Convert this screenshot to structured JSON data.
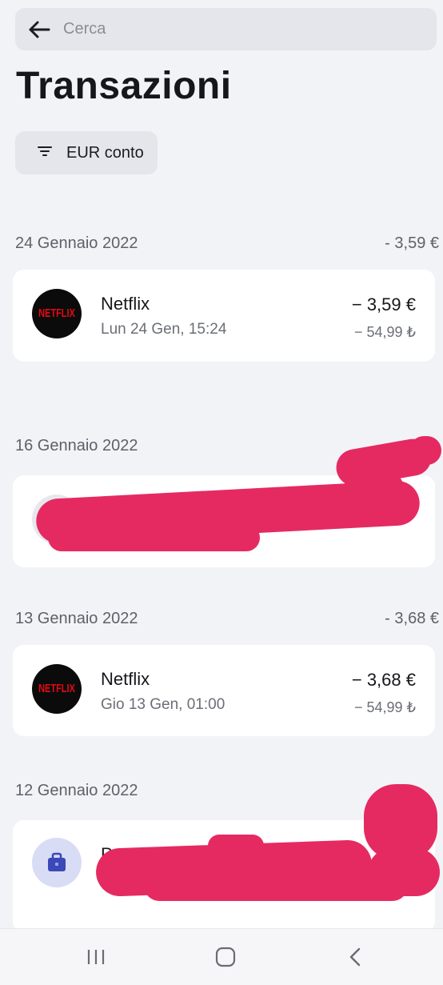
{
  "search": {
    "placeholder": "Cerca"
  },
  "page": {
    "title": "Transazioni"
  },
  "filter": {
    "label": "EUR conto"
  },
  "groups": [
    {
      "date": "24 Gennaio 2022",
      "total": "- 3,59 €",
      "transaction": {
        "merchant": "Netflix",
        "logo_text": "NETFLIX",
        "datetime": "Lun 24 Gen, 15:24",
        "amount": "− 3,59 €",
        "sub_amount": "− 54,99 ₺"
      }
    },
    {
      "date": "16 Gennaio 2022",
      "total": "",
      "transaction": {
        "redacted": true
      }
    },
    {
      "date": "13 Gennaio 2022",
      "total": "- 3,68 €",
      "transaction": {
        "merchant": "Netflix",
        "logo_text": "NETFLIX",
        "datetime": "Gio 13 Gen, 01:00",
        "amount": "− 3,68 €",
        "sub_amount": "− 54,99 ₺"
      }
    },
    {
      "date": "12 Gennaio 2022",
      "total": "",
      "transaction": {
        "merchant_partial": "Pp",
        "icon": "briefcase-icon",
        "redacted": true
      }
    }
  ],
  "colors": {
    "background": "#f2f3f7",
    "redaction": "#e52a62",
    "netflix_red": "#e50914"
  },
  "navbar": {
    "items": [
      "recent-apps-icon",
      "home-icon",
      "back-icon"
    ]
  }
}
